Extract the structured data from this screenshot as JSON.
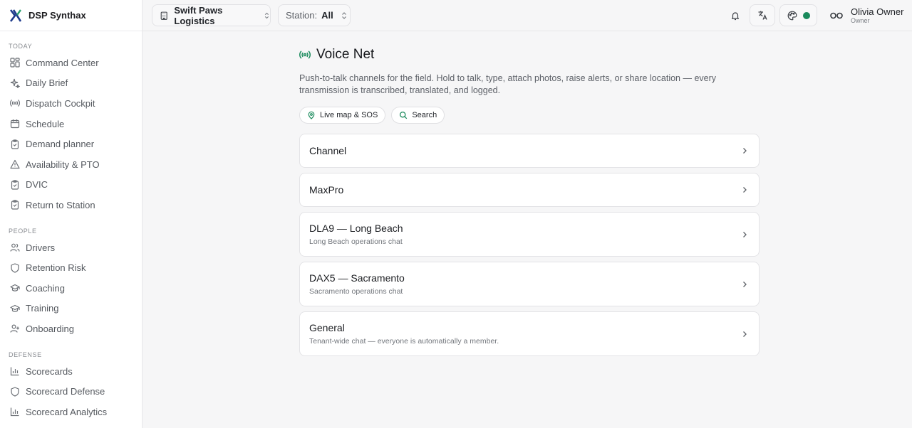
{
  "app": {
    "name": "DSP Synthax"
  },
  "sidebar": {
    "sections": [
      {
        "label": "TODAY",
        "items": [
          {
            "label": "Command Center",
            "icon": "grid-icon"
          },
          {
            "label": "Daily Brief",
            "icon": "sparkle-icon"
          },
          {
            "label": "Dispatch Cockpit",
            "icon": "radio-icon"
          },
          {
            "label": "Schedule",
            "icon": "calendar-icon"
          },
          {
            "label": "Demand planner",
            "icon": "clipboard-icon"
          },
          {
            "label": "Availability & PTO",
            "icon": "alert-triangle-icon"
          },
          {
            "label": "DVIC",
            "icon": "clipboard-check-icon"
          },
          {
            "label": "Return to Station",
            "icon": "clipboard-check-icon"
          }
        ]
      },
      {
        "label": "PEOPLE",
        "items": [
          {
            "label": "Drivers",
            "icon": "users-icon"
          },
          {
            "label": "Retention Risk",
            "icon": "shield-icon"
          },
          {
            "label": "Coaching",
            "icon": "graduation-cap-icon"
          },
          {
            "label": "Training",
            "icon": "graduation-cap-icon"
          },
          {
            "label": "Onboarding",
            "icon": "user-plus-icon"
          }
        ]
      },
      {
        "label": "DEFENSE",
        "items": [
          {
            "label": "Scorecards",
            "icon": "bar-chart-icon"
          },
          {
            "label": "Scorecard Defense",
            "icon": "shield-icon"
          },
          {
            "label": "Scorecard Analytics",
            "icon": "bar-chart-icon"
          }
        ]
      }
    ]
  },
  "topbar": {
    "org_name": "Swift Paws Logistics",
    "station_label": "Station:",
    "station_value": "All",
    "user_name": "Olivia Owner",
    "user_role": "Owner",
    "status_color": "#1a8a5c"
  },
  "main": {
    "title": "Voice Net",
    "description": "Push-to-talk channels for the field. Hold to talk, type, attach photos, raise alerts, or share location — every transmission is transcribed, translated, and logged.",
    "chips": [
      {
        "label": "Live map & SOS",
        "icon": "map-pin-icon"
      },
      {
        "label": "Search",
        "icon": "search-icon"
      }
    ],
    "channels": [
      {
        "title": "Channel",
        "subtitle": ""
      },
      {
        "title": "MaxPro",
        "subtitle": ""
      },
      {
        "title": "DLA9 — Long Beach",
        "subtitle": "Long Beach operations chat"
      },
      {
        "title": "DAX5 — Sacramento",
        "subtitle": "Sacramento operations chat"
      },
      {
        "title": "General",
        "subtitle": "Tenant-wide chat — everyone is automatically a member."
      }
    ]
  },
  "accent_color": "#1a8a5c"
}
